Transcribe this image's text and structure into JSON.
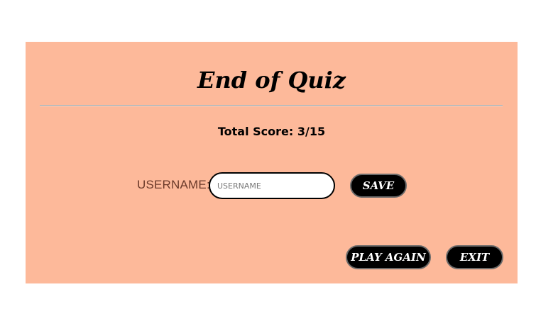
{
  "quiz_end": {
    "title": "End of Quiz",
    "score_text": "Total Score: 3/15",
    "username_label": "USERNAME:",
    "username_input": {
      "value": "",
      "placeholder": "USERNAME"
    },
    "save_label": "SAVE",
    "play_again_label": "PLAY AGAIN",
    "exit_label": "EXIT"
  },
  "colors": {
    "panel_background": "#fdb99a",
    "button_background": "#000000",
    "button_text": "#ffffff",
    "label_color": "#6b3a2a"
  }
}
